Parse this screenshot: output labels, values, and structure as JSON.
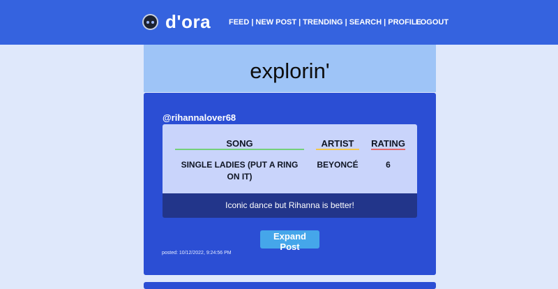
{
  "app": {
    "name": "d'ora",
    "logo_icon": "robot-face-icon"
  },
  "nav": {
    "items": [
      {
        "label": "FEED"
      },
      {
        "label": "NEW POST"
      },
      {
        "label": "TRENDING"
      },
      {
        "label": "SEARCH"
      },
      {
        "label": "PROFILE"
      }
    ],
    "separator": "|",
    "logout_label": "LOGOUT"
  },
  "page": {
    "title": "explorin'"
  },
  "post": {
    "username": "@rihannalover68",
    "columns": {
      "song": "SONG",
      "artist": "ARTIST",
      "rating": "RATING"
    },
    "song": "SINGLE LADIES (PUT A RING ON IT)",
    "artist": "BEYONCÉ",
    "rating": "6",
    "caption": "Iconic dance but Rihanna is better!",
    "expand_label": "Expand Post",
    "posted": "posted: 10/12/2022, 9:24:56 PM"
  },
  "colors": {
    "header": "#3563df",
    "page_background": "#dfe8fb",
    "title_band": "#9ec4f7",
    "card": "#2b4ed4",
    "song_table": "#c9d4fb",
    "caption_bar": "#22358a",
    "button": "#45a6ea",
    "song_underline": "#74d07a",
    "artist_underline": "#f2c84b",
    "rating_underline": "#e46a6a"
  }
}
